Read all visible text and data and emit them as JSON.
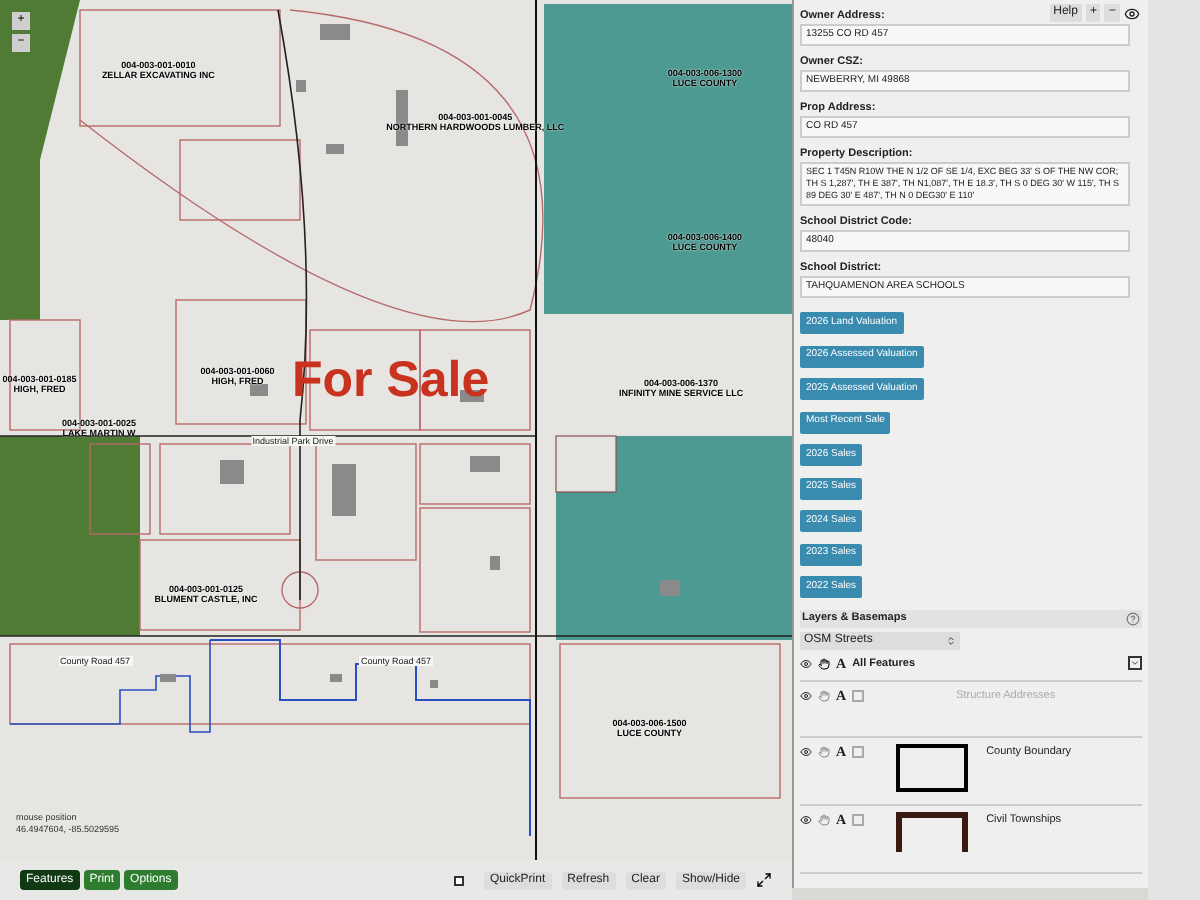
{
  "map": {
    "zoom_controls": [
      "+",
      "−"
    ],
    "parcel_labels": [
      {
        "id": "004-003-001-0010",
        "owner": "ZELLAR EXCAVATING INC"
      },
      {
        "id": "004-003-001-0045",
        "owner": "NORTHERN HARDWOODS LUMBER, LLC"
      },
      {
        "id": "004-003-006-1300",
        "owner": "LUCE COUNTY"
      },
      {
        "id": "004-003-006-1400",
        "owner": "LUCE COUNTY"
      },
      {
        "id": "004-003-001-0060",
        "owner": "HIGH, FRED"
      },
      {
        "id": "004-003-001-0185",
        "owner": "HIGH, FRED"
      },
      {
        "id": "004-003-001-0025",
        "owner": "LAKE MARTIN W"
      },
      {
        "id": "004-003-006-1370",
        "owner": "INFINITY MINE SERVICE LLC"
      },
      {
        "id": "004-003-001-0125",
        "owner": "BLUMENT CASTLE, INC"
      },
      {
        "id": "004-003-006-1500",
        "owner": "LUCE COUNTY"
      }
    ],
    "street_labels": [
      "Industrial Park Drive",
      "County Road 457",
      "County Road 457"
    ],
    "banner": "For Sale",
    "mouse_position": {
      "label": "mouse position",
      "coords": "46.4947604, -85.5029595"
    }
  },
  "bottom_bar": {
    "tabs": [
      {
        "label": "Features",
        "selected": true
      },
      {
        "label": "Print",
        "selected": false
      },
      {
        "label": "Options",
        "selected": false
      }
    ],
    "checkbox": {
      "checked": false
    },
    "buttons": [
      "QuickPrint",
      "Refresh",
      "Clear",
      "Show/Hide"
    ]
  },
  "panel": {
    "header_buttons": [
      "Help",
      "+",
      "−"
    ],
    "fields": [
      {
        "label": "Owner Address:",
        "value": "13255 CO RD 457",
        "kind": "input"
      },
      {
        "label": "Owner CSZ:",
        "value": "NEWBERRY, MI 49868",
        "kind": "input"
      },
      {
        "label": "Prop Address:",
        "value": "CO RD 457",
        "kind": "input"
      },
      {
        "label": "Property Description:",
        "value": "SEC 1 T45N R10W THE N 1/2 OF SE 1/4, EXC BEG 33' S OF THE NW COR; TH S 1,287', TH E 387', TH N1,087', TH E 18.3', TH S 0 DEG 30' W 115', TH S 89 DEG 30' E 487', TH N 0 DEG30' E 110'",
        "kind": "textarea"
      },
      {
        "label": "School District Code:",
        "value": "48040",
        "kind": "input"
      },
      {
        "label": "School District:",
        "value": "TAHQUAMENON AREA SCHOOLS",
        "kind": "input"
      }
    ],
    "action_buttons": [
      "2026 Land Valuation",
      "2026 Assessed Valuation",
      "2025 Assessed Valuation",
      "Most Recent Sale",
      "2026 Sales",
      "2025 Sales",
      "2024 Sales",
      "2023 Sales",
      "2022 Sales"
    ],
    "layers_title": "Layers & Basemaps",
    "basemap": "OSM Streets",
    "layers": [
      {
        "name": "All Features",
        "label_toggle": "A",
        "kind": "all",
        "dimmed": false
      },
      {
        "name": "Structure Addresses",
        "label_toggle": "A",
        "kind": "none",
        "dimmed": true
      },
      {
        "name": "County Boundary",
        "label_toggle": "A",
        "kind": "box",
        "dimmed": false
      },
      {
        "name": "Civil Townships",
        "label_toggle": "A",
        "kind": "township",
        "dimmed": false
      }
    ]
  }
}
